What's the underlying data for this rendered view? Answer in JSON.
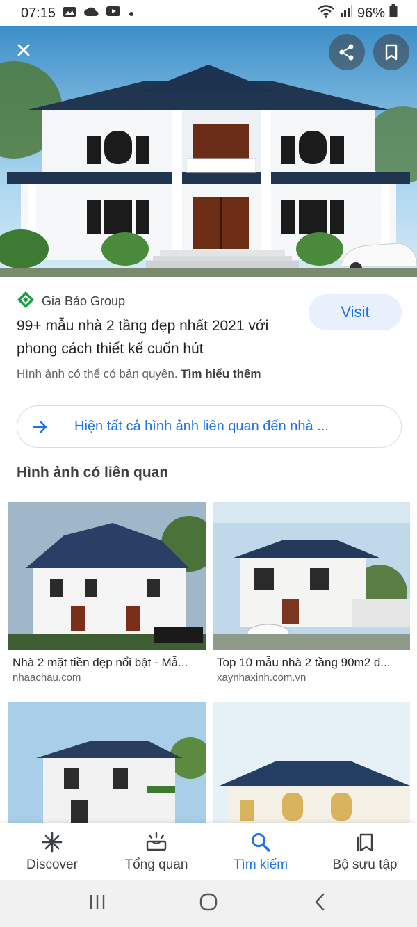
{
  "status_bar": {
    "time": "07:15",
    "battery": "96%"
  },
  "hero": {
    "close_label": "close",
    "share_label": "share",
    "save_label": "save"
  },
  "result": {
    "source": "Gia Bảo Group",
    "title": "99+ mẫu nhà 2 tầng đẹp nhất 2021 với phong cách thiết kế cuốn hút",
    "visit_label": "Visit",
    "copyright_text": "Hình ảnh có thể có bản quyền.",
    "learn_more": "Tìm hiểu thêm",
    "brand_color": "#1a9e47"
  },
  "related_button": {
    "label": "Hiện tất cả hình ảnh liên quan đến nhà ..."
  },
  "related": {
    "heading": "Hình ảnh có liên quan",
    "items": [
      {
        "caption": "Nhà 2 mặt tiền đẹp nổi bật - Mẫ...",
        "source": "nhaachau.com"
      },
      {
        "caption": "Top 10 mẫu nhà 2 tầng 90m2 đ...",
        "source": "xaynhaxinh.com.vn"
      },
      {
        "caption": "",
        "source": ""
      },
      {
        "caption": "",
        "source": ""
      }
    ]
  },
  "bottom_nav": {
    "items": [
      {
        "label": "Discover",
        "icon": "asterisk-icon"
      },
      {
        "label": "Tổng quan",
        "icon": "overview-icon"
      },
      {
        "label": "Tìm kiếm",
        "icon": "search-icon"
      },
      {
        "label": "Bộ sưu tập",
        "icon": "collections-icon"
      }
    ],
    "active_index": 2
  },
  "colors": {
    "accent": "#1a73e8",
    "visit_bg": "#e8f0fe"
  }
}
